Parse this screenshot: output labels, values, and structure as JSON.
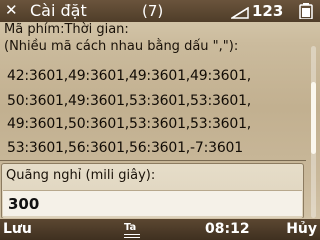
{
  "status_bar": {
    "title": "Cài đặt",
    "item_count": "(7)",
    "signal_value": "123",
    "icons": [
      "close-icon",
      "signal-icon",
      "battery-icon"
    ]
  },
  "field_label": {
    "line1": "Mã phím:Thời gian:",
    "line2": "(Nhiều mã cách nhau bằng dấu \",\"):"
  },
  "code_lines": [
    "42:3601,49:3601,49:3601,49:3601,",
    "50:3601,49:3601,53:3601,53:3601,",
    "49:3601,50:3601,53:3601,53:3601,",
    "53:3601,56:3601,56:3601,-7:3601"
  ],
  "pause": {
    "label": "Quãng nghỉ (mili giây):",
    "value": "300"
  },
  "softkeys": {
    "left": "Lưu",
    "input_mode": "Ta",
    "time": "08:12",
    "right": "Hủy"
  },
  "colors": {
    "bar_bg": "#4f3d29",
    "content_bg": "#c2b090",
    "text": "#1a1209"
  }
}
